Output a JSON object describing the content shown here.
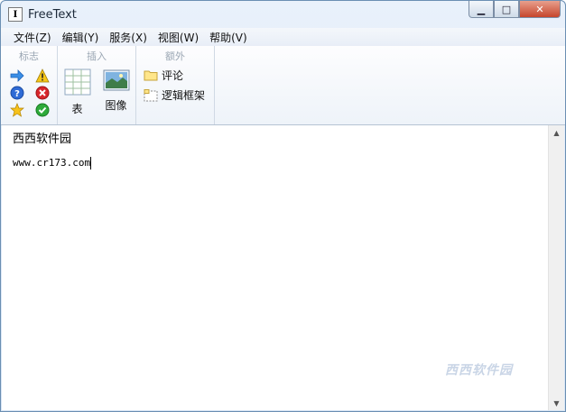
{
  "window": {
    "title": "FreeText"
  },
  "titlebar": {
    "icon_glyph": "I",
    "min": "▁",
    "max": "□",
    "close": "✕"
  },
  "menu": {
    "items": [
      "文件(Z)",
      "编辑(Y)",
      "服务(X)",
      "视图(W)",
      "帮助(V)"
    ]
  },
  "toolbar": {
    "flags": {
      "label": "标志",
      "icons": [
        "arrow-right-icon",
        "warning-icon",
        "help-icon",
        "error-icon",
        "star-icon",
        "check-icon"
      ]
    },
    "insert": {
      "label": "插入",
      "table_label": "表",
      "image_label": "图像"
    },
    "extra": {
      "label": "额外",
      "comment_label": "评论",
      "logic_frame_label": "逻辑框架"
    }
  },
  "editor": {
    "line1": "西西软件园",
    "line2": "www.cr173.com"
  },
  "watermark": {
    "text": "西西软件园"
  }
}
